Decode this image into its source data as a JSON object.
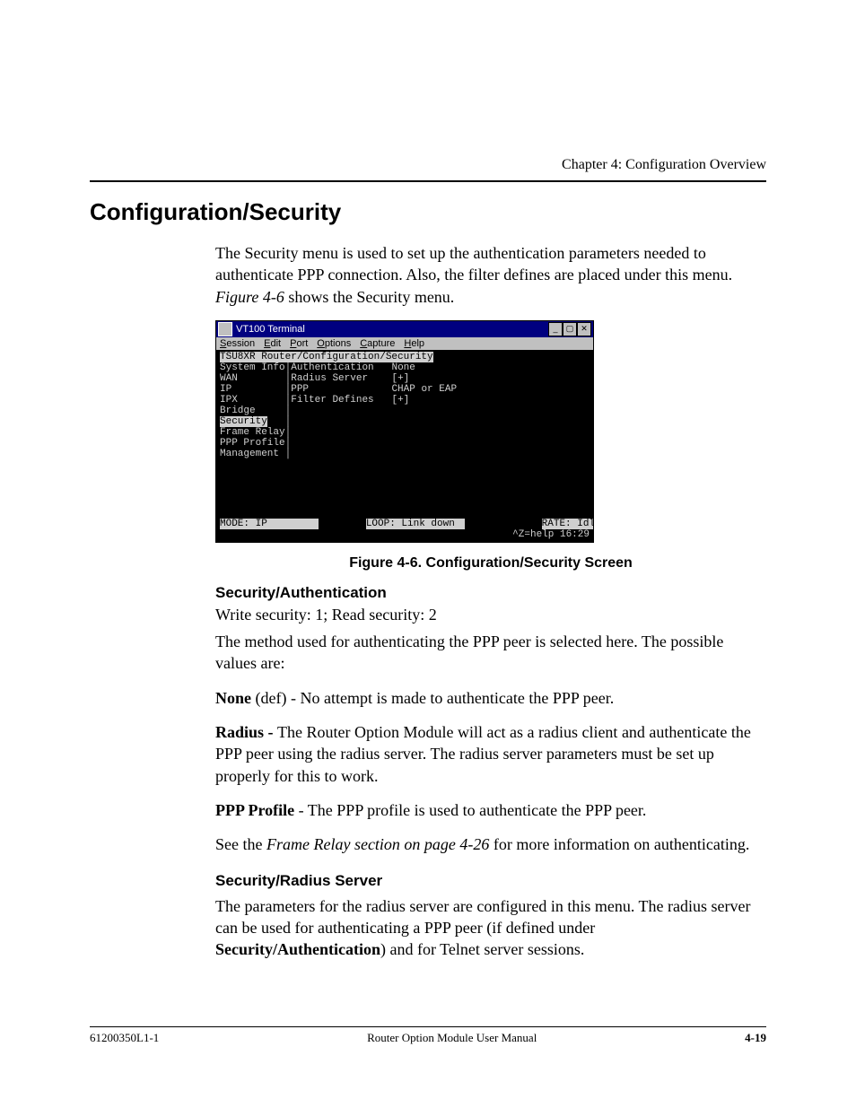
{
  "header": {
    "chapter": "Chapter 4:  Configuration Overview"
  },
  "title": "Configuration/Security",
  "intro": "The Security menu is used to set up the authentication parameters needed to authenticate PPP connection.  Also, the filter defines are placed under this menu. ",
  "intro_figref_pre": "Figure 4-6",
  "intro_figref_post": " shows the Security menu.",
  "terminal": {
    "window_title": "VT100 Terminal",
    "menu": {
      "m0": "Session",
      "m1": "Edit",
      "m2": "Port",
      "m3": "Options",
      "m4": "Capture",
      "m5": "Help"
    },
    "path": "TSU8XR Router/Configuration/Security",
    "left": {
      "l0": "System Info",
      "l1": "WAN",
      "l2": "IP",
      "l3": "IPX",
      "l4": "Bridge",
      "l5": "Security",
      "l6": "Frame Relay",
      "l7": "PPP Profile",
      "l8": "Management"
    },
    "right": {
      "r0": {
        "k": "Authentication",
        "v": "None"
      },
      "r1": {
        "k": "Radius Server",
        "v": "[+]"
      },
      "r2": {
        "k": "PPP",
        "v": "CHAP or EAP"
      },
      "r3": {
        "k": "Filter Defines",
        "v": "[+]"
      }
    },
    "status": {
      "mode": "MODE: IP",
      "loop": "LOOP: Link down",
      "rate": "RATE: Idle"
    },
    "help": "^Z=help 16:29"
  },
  "fig_caption_label": "Figure 4-6.  ",
  "fig_caption_title": "Configuration/Security Screen",
  "sec_auth": {
    "head": "Security/Authentication",
    "line1": "Write security: 1; Read security: 2",
    "line2": "The method used for authenticating the PPP peer is selected here. The possible values are:",
    "none_b": "None",
    "none_t": " (def) - No attempt is made to authenticate the PPP peer.",
    "radius_b": "Radius - ",
    "radius_t": "The Router Option Module will act as a radius client and authenticate the PPP peer using the radius server. The radius server parameters must be set up properly for this to work.",
    "ppp_b": "PPP Profile",
    "ppp_t": " - The PPP profile is used to authenticate the PPP peer.",
    "see_pre": "See the ",
    "see_it": "Frame Relay section on page 4-26",
    "see_post": " for more information on authenticating."
  },
  "sec_radius": {
    "head": "Security/Radius Server",
    "body_pre": "The parameters for the radius server are configured in this menu. The radius server can be used for authenticating a PPP peer (if defined under ",
    "body_b": "Security/Authentication",
    "body_post": ") and for Telnet server sessions."
  },
  "footer": {
    "left": "61200350L1-1",
    "center": "Router Option Module User Manual",
    "right": "4-19"
  }
}
